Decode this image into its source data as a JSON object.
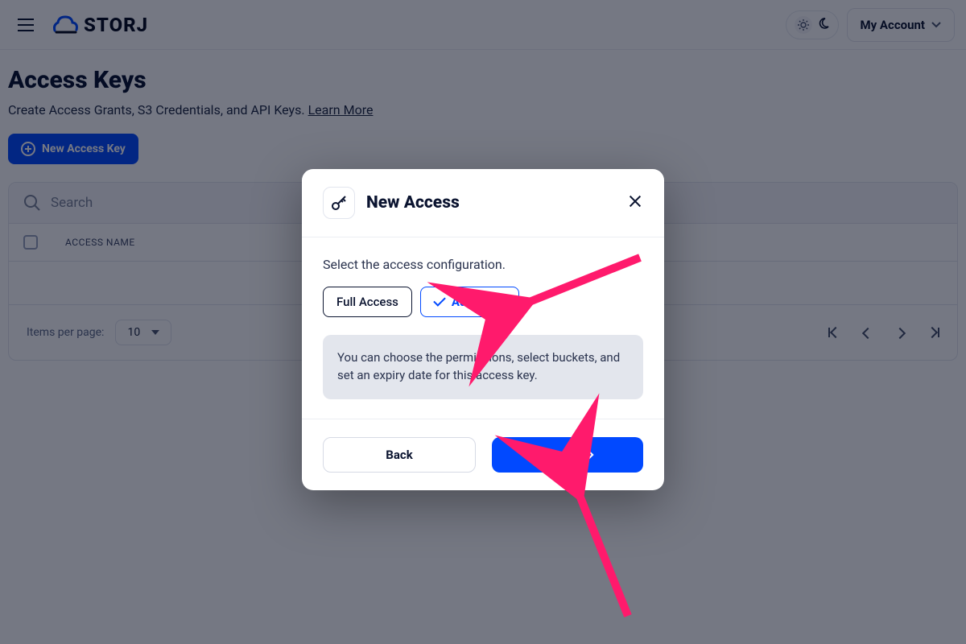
{
  "header": {
    "brand": "STORJ",
    "account_label": "My Account"
  },
  "page": {
    "title": "Access Keys",
    "subtitle_prefix": "Create Access Grants, S3 Credentials, and API Keys. ",
    "learn_more": "Learn More",
    "new_key_button": "New Access Key"
  },
  "table": {
    "search_placeholder": "Search",
    "col_access_name": "ACCESS NAME",
    "items_per_page_label": "Items per page:",
    "items_per_page_value": "10"
  },
  "modal": {
    "title": "New Access",
    "instruction": "Select the access configuration.",
    "option_full": "Full Access",
    "option_advanced": "Advanced",
    "info_text": "You can choose the permissions, select buckets, and set an expiry date for this access key.",
    "back": "Back",
    "next": "Next"
  },
  "colors": {
    "accent": "#0149ff",
    "annotation": "#ff1a6c"
  }
}
